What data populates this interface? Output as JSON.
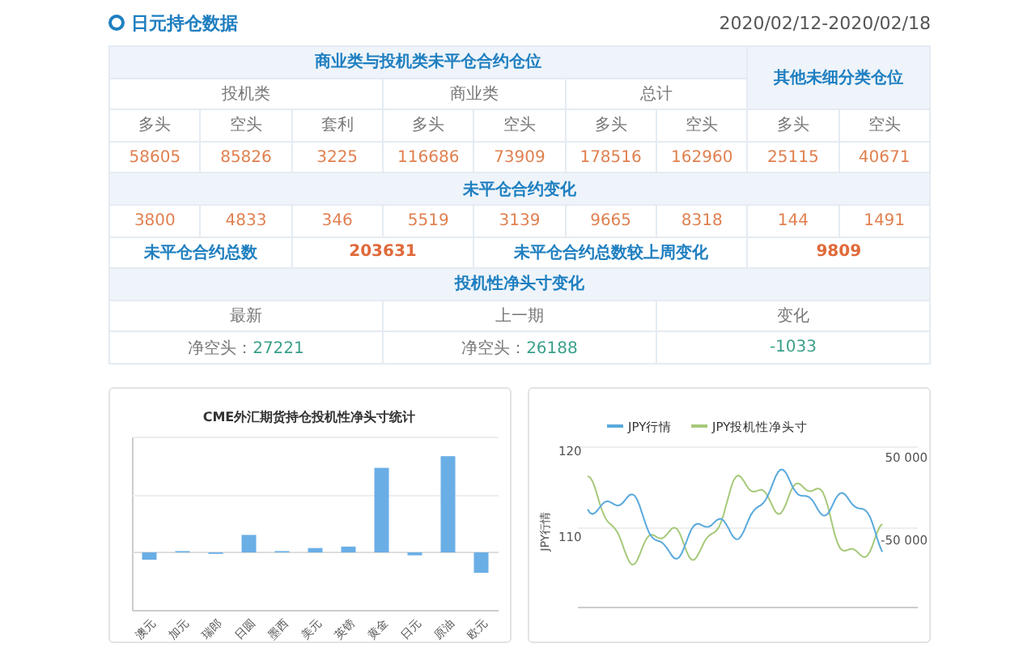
{
  "header": {
    "title": "日元持仓数据",
    "date_range": "2020/02/12-2020/02/18"
  },
  "positions_table": {
    "title": "商业类与投机类未平仓合约仓位",
    "other_title": "其他未细分类仓位",
    "groups": [
      {
        "label": "投机类",
        "columns": [
          "多头",
          "空头",
          "套利"
        ]
      },
      {
        "label": "商业类",
        "columns": [
          "多头",
          "空头"
        ]
      },
      {
        "label": "总计",
        "columns": [
          "多头",
          "空头"
        ]
      }
    ],
    "other_columns": [
      "多头",
      "空头"
    ],
    "values": [
      "58605",
      "85826",
      "3225",
      "116686",
      "73909",
      "178516",
      "162960",
      "25115",
      "40671"
    ],
    "change_title": "未平仓合约变化",
    "changes": [
      "3800",
      "4833",
      "346",
      "5519",
      "3139",
      "9665",
      "8318",
      "144",
      "1491"
    ],
    "total_label": "未平仓合约总数",
    "total_value": "203631",
    "weekly_change_label": "未平仓合约总数较上周变化",
    "weekly_change_value": "9809"
  },
  "net_position": {
    "title": "投机性净头寸变化",
    "columns": [
      {
        "header": "最新",
        "prefix": "净空头：",
        "value": "27221"
      },
      {
        "header": "上一期",
        "prefix": "净空头：",
        "value": "26188"
      },
      {
        "header": "变化",
        "value": "-1033"
      }
    ]
  },
  "bar_chart": {
    "title": "CME外汇期货持仓投机性净头寸统计",
    "categories": [
      "澳元",
      "加元",
      "瑞郎",
      "日圆",
      "墨西",
      "美元",
      "英镑",
      "黄金",
      "日元",
      "原油",
      "欧元"
    ]
  },
  "line_chart": {
    "legend": [
      {
        "label": "JPY行情",
        "color": "#5aa9dd"
      },
      {
        "label": "JPY投机性净头寸",
        "color": "#a6c97a"
      }
    ],
    "y_axis_title": "JPY行情",
    "left_ticks": [
      "120",
      "110"
    ],
    "right_ticks": [
      "50 000",
      "-50 000"
    ]
  }
}
